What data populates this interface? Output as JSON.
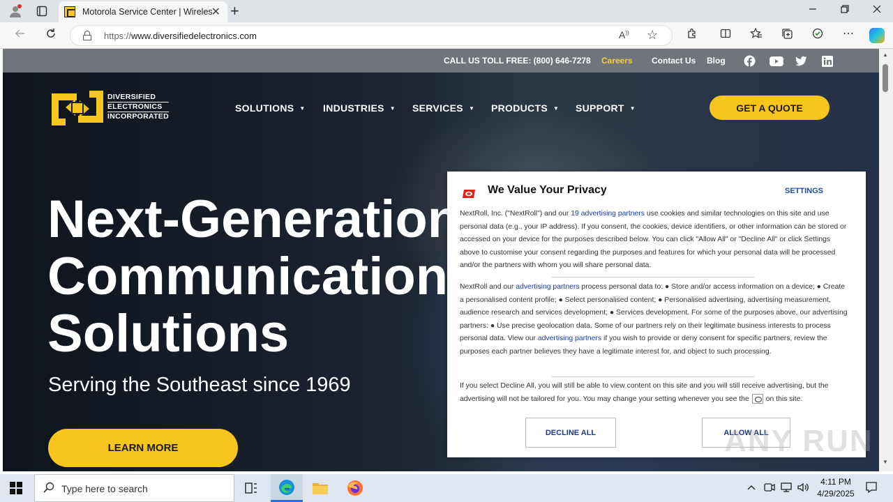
{
  "browser": {
    "tab_title": "Motorola Service Center | Wireless",
    "url_prefix": "https://",
    "url_domain": "www.diversifiedelectronics.com",
    "read_aloud": "A",
    "new_tab": "+",
    "close_tab": "✕"
  },
  "site": {
    "utility": {
      "phone": "CALL US TOLL FREE: (800) 646-7278",
      "careers": "Careers",
      "contact": "Contact Us",
      "blog": "Blog"
    },
    "logo": {
      "line1": "DIVERSIFIED",
      "line2": "ELECTRONICS",
      "line3": "INCORPORATED"
    },
    "nav": [
      "SOLUTIONS",
      "INDUSTRIES",
      "SERVICES",
      "PRODUCTS",
      "SUPPORT"
    ],
    "quote_button": "GET A QUOTE",
    "hero": {
      "line1": "Next-Generation",
      "line2": "Communication",
      "line3": "Solutions",
      "subtitle": "Serving the Southeast since 1969",
      "cta": "LEARN MORE"
    }
  },
  "consent": {
    "title": "We Value Your Privacy",
    "settings": "SETTINGS",
    "p1_a": "NextRoll, Inc. (\"NextRoll\") and our ",
    "p1_link": "19 advertising partners",
    "p1_b": " use cookies and similar technologies on this site and use personal data (e.g., your IP address). If you consent, the cookies, device identifiers, or other information can be stored or accessed on your device for the purposes described below. You can click \"Allow All\" or \"Decline All\" or click Settings above to customise your consent regarding the purposes and features for which your personal data will be processed and/or the partners with whom you will share personal data.",
    "p2_a": "NextRoll and our ",
    "p2_link1": "advertising partners",
    "p2_b": " process personal data to: ● Store and/or access information on a device; ● Create a personalised content profile; ● Select personalised content; ● Personalised advertising, advertising measurement, audience research and services development; ● Services development. For some of the purposes above, our advertising partners: ● Use precise geolocation data. Some of our partners rely on their legitimate business interests to process personal data. View our ",
    "p2_link2": "advertising partners",
    "p2_c": " if you wish to provide or deny consent for specific partners, review the purposes each partner believes they have a legitimate interest for, and object to such processing.",
    "p3_a": "If you select Decline All, you will still be able to view content on this site and you will still receive advertising, but the advertising will not be tailored for you. You may change your setting whenever you see the",
    "p3_b": "on this site.",
    "decline": "DECLINE ALL",
    "allow": "ALLOW ALL"
  },
  "watermark": "ANY RUN",
  "taskbar": {
    "search_placeholder": "Type here to search",
    "time": "4:11 PM",
    "date": "4/29/2025"
  },
  "colors": {
    "accent_yellow": "#f7c61e",
    "careers_yellow": "#f7d22d",
    "link_blue": "#1a3aa8",
    "nextroll_red": "#e2231a"
  }
}
